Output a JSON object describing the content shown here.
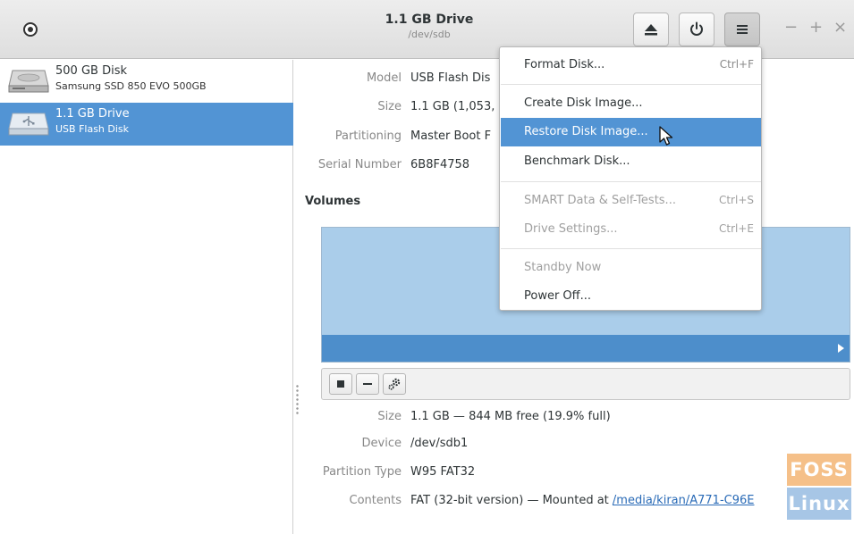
{
  "header": {
    "title": "1.1 GB Drive",
    "subtitle": "/dev/sdb",
    "eject_icon": "eject-icon",
    "power_icon": "power-icon",
    "menu_icon": "hamburger-icon",
    "window_controls": {
      "minimize": "−",
      "maximize": "+",
      "close": "×"
    }
  },
  "sidebar": {
    "items": [
      {
        "name": "500 GB Disk",
        "description": "Samsung SSD 850 EVO 500GB",
        "icon": "hard-disk-icon",
        "selected": false
      },
      {
        "name": "1.1 GB Drive",
        "description": "USB Flash Disk",
        "icon": "usb-drive-icon",
        "selected": true
      }
    ]
  },
  "drive_info": {
    "model_label": "Model",
    "model_value": "USB Flash Dis",
    "size_label": "Size",
    "size_value": "1.1 GB (1,053,",
    "partitioning_label": "Partitioning",
    "partitioning_value": "Master Boot F",
    "serial_label": "Serial Number",
    "serial_value": "6B8F4758"
  },
  "volumes": {
    "title": "Volumes",
    "toolbar": {
      "stop_icon": "stop-icon",
      "remove_icon": "minus-icon",
      "settings_icon": "gears-icon"
    },
    "size_label": "Size",
    "size_value": "1.1 GB — 844 MB free (19.9% full)",
    "device_label": "Device",
    "device_value": "/dev/sdb1",
    "ptype_label": "Partition Type",
    "ptype_value": "W95 FAT32",
    "contents_label": "Contents",
    "contents_value": "FAT (32-bit version) — Mounted at ",
    "contents_link": "/media/kiran/A771-C96E"
  },
  "menu": {
    "items": [
      {
        "label": "Format Disk...",
        "accel": "Ctrl+F",
        "enabled": true
      },
      {
        "label": "Create Disk Image...",
        "accel": "",
        "enabled": true
      },
      {
        "label": "Restore Disk Image...",
        "accel": "",
        "enabled": true,
        "highlighted": true
      },
      {
        "label": "Benchmark Disk...",
        "accel": "",
        "enabled": true
      },
      {
        "label": "SMART Data & Self-Tests...",
        "accel": "Ctrl+S",
        "enabled": false
      },
      {
        "label": "Drive Settings...",
        "accel": "Ctrl+E",
        "enabled": false
      },
      {
        "label": "Standby Now",
        "accel": "",
        "enabled": false
      },
      {
        "label": "Power Off...",
        "accel": "",
        "enabled": true
      }
    ]
  },
  "watermark": {
    "top": "FOSS",
    "bottom": "Linux"
  },
  "colors": {
    "selection": "#5294d4",
    "volume_fill": "#aacdea",
    "volume_bar": "#4d8ecb"
  }
}
